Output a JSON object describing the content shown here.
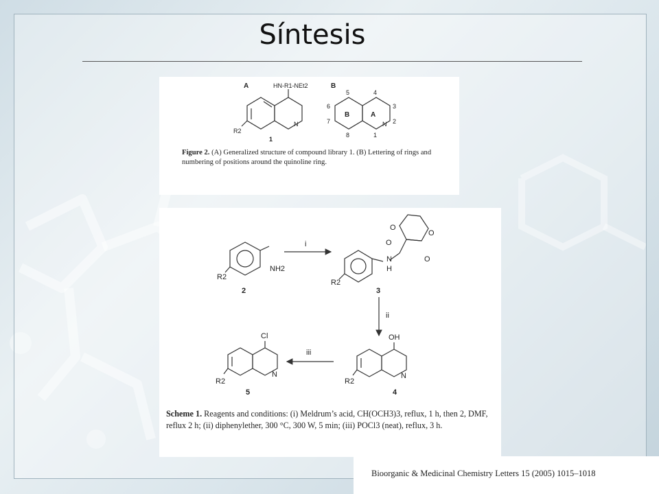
{
  "slide": {
    "title": "Síntesis",
    "figure2": {
      "label_a": "A",
      "label_b": "B",
      "substituent_a": "HN-R1-NEt2",
      "r2_label": "R2",
      "n_label": "N",
      "compound_number": "1",
      "ring_b": "B",
      "ring_a": "A",
      "positions": {
        "p5": "5",
        "p4": "4",
        "p6": "6",
        "p3": "3",
        "p7": "7",
        "p2": "2",
        "p8": "8",
        "p1": "1"
      },
      "caption_bold": "Figure 2.",
      "caption_text": " (A) Generalized structure of compound library 1. (B) Lettering of rings and numbering of positions around the quinoline ring."
    },
    "scheme1": {
      "nh2": "NH2",
      "r2": "R2",
      "n": "N",
      "h": "H",
      "o": "O",
      "cl": "Cl",
      "oh": "OH",
      "compounds": {
        "c2": "2",
        "c3": "3",
        "c4": "4",
        "c5": "5"
      },
      "steps": {
        "i": "i",
        "ii": "ii",
        "iii": "iii"
      },
      "caption_bold": "Scheme 1.",
      "caption_text": " Reagents and conditions: (i) Meldrum’s acid, CH(OCH3)3, reflux, 1 h, then 2, DMF, reflux 2 h; (ii) diphenylether, 300 °C, 300 W, 5 min; (iii) POCl3 (neat), reflux, 3 h."
    },
    "citation": "Bioorganic & Medicinal Chemistry Letters 15 (2005) 1015–1018"
  }
}
